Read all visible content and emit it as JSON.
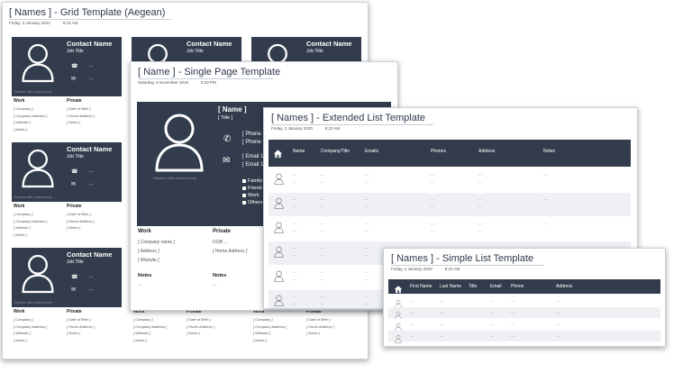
{
  "grid": {
    "title": "[ Names ] - Grid Template (Aegean)",
    "date": "Friday, 3 January 2020",
    "time": "8:23 AM",
    "card": {
      "name": "Contact Name",
      "job": "Job Title",
      "dash": "...",
      "placeholder": "Replace with contact photo",
      "work": "Work",
      "private": "Private",
      "work_fields": [
        "[ Company ]",
        "[ Company Address ]",
        "[ Website ]",
        "[ Notes ]"
      ],
      "private_fields": [
        "[ Date of Birth ]",
        "[ Home Address ]",
        "",
        "[ Notes ]"
      ]
    }
  },
  "single": {
    "title": "[ Name ] - Single Page Template",
    "date": "Saturday, 9 November 2019",
    "time": "5:23 PM",
    "name": "[ Name ]",
    "job": "[ Title ]",
    "phone1": "[ Phone 1",
    "phone2": "[ Phone 1",
    "email1": "[ Email 1 ]",
    "email2": "[ Email 1 ]",
    "groups": [
      "Family",
      "Friend",
      "Work",
      "Others"
    ],
    "placeholder": "Replace with contact photo",
    "work": "Work",
    "private": "Private",
    "work_fields": [
      "[ Company name ]",
      "[ Address ]",
      "[ Website ]"
    ],
    "private_fields": [
      "DOB ...",
      "[ Home Address ]"
    ],
    "notes": "Notes",
    "dash": "..."
  },
  "extended": {
    "title": "[ Names ] - Extended List Template",
    "date": "Friday, 3 January 2020",
    "time": "8:23 AM",
    "headers": [
      "Name",
      "Company/Title",
      "Emails",
      "Phones",
      "Address",
      "Notes"
    ],
    "dash": "..."
  },
  "simple": {
    "title": "[ Names ] - Simple List Template",
    "date": "Friday, 3 January 2020",
    "time": "8:23 AM",
    "headers": [
      "First Name",
      "Last Name",
      "Title",
      "Email",
      "Phone",
      "Address"
    ],
    "dash": "..."
  },
  "colors": {
    "dark": "#323c4c",
    "stripe": "#eef0f3",
    "border": "#c9d0d8"
  }
}
